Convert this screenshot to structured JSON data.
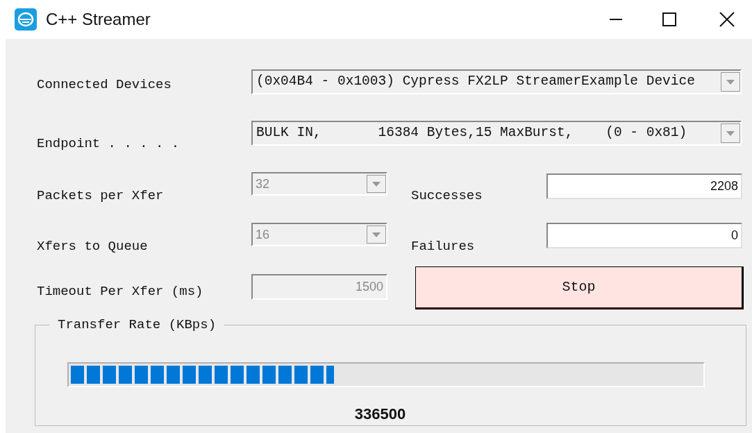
{
  "window": {
    "title": "C++ Streamer"
  },
  "connected_devices": {
    "label": "Connected Devices",
    "value": "(0x04B4 - 0x1003) Cypress FX2LP StreamerExample Device"
  },
  "endpoint": {
    "label": "Endpoint . . . . .",
    "value": "BULK IN,       16384 Bytes,15 MaxBurst,    (0 - 0x81)"
  },
  "packets_per_xfer": {
    "label": "Packets per Xfer",
    "value": "32",
    "disabled": true
  },
  "xfers_to_queue": {
    "label": "Xfers to Queue",
    "value": "16",
    "disabled": true
  },
  "timeout": {
    "label": "Timeout Per Xfer (ms)",
    "value": "1500",
    "disabled": true
  },
  "successes": {
    "label": "Successes",
    "value": "2208"
  },
  "failures": {
    "label": "Failures",
    "value": "0"
  },
  "stop_button": {
    "label": "Stop"
  },
  "transfer_rate": {
    "title": "Transfer Rate (KBps)",
    "level": 0.417,
    "reading": "336500"
  }
}
